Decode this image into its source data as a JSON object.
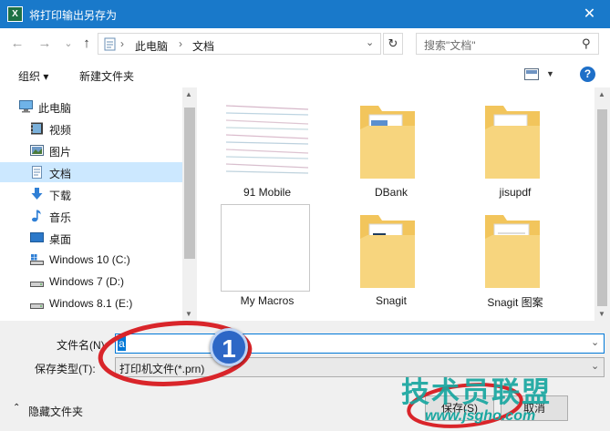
{
  "window": {
    "title": "将打印输出另存为",
    "app_icon": "X",
    "close": "✕"
  },
  "nav": {
    "back": "←",
    "forward": "→",
    "recent": "⌄",
    "up": "↑",
    "breadcrumb": [
      "此电脑",
      "文档"
    ],
    "separator": "›",
    "search_placeholder": "搜索\"文档\"",
    "refresh": "↻"
  },
  "toolbar": {
    "organize": "组织 ▾",
    "new_folder": "新建文件夹",
    "help": "?"
  },
  "sidebar": {
    "items": [
      {
        "label": "此电脑",
        "icon": "pc-icon"
      },
      {
        "label": "视频",
        "icon": "video-icon"
      },
      {
        "label": "图片",
        "icon": "picture-icon"
      },
      {
        "label": "文档",
        "icon": "document-icon"
      },
      {
        "label": "下载",
        "icon": "download-icon"
      },
      {
        "label": "音乐",
        "icon": "music-icon"
      },
      {
        "label": "桌面",
        "icon": "desktop-icon"
      },
      {
        "label": "Windows 10 (C:)",
        "icon": "drive-icon"
      },
      {
        "label": "Windows 7 (D:)",
        "icon": "drive-icon"
      },
      {
        "label": "Windows 8.1 (E:)",
        "icon": "drive-icon"
      }
    ]
  },
  "files": [
    {
      "name": "91 Mobile",
      "type": "image-thumbnail"
    },
    {
      "name": "DBank",
      "type": "folder"
    },
    {
      "name": "jisupdf",
      "type": "folder"
    },
    {
      "name": "My Macros",
      "type": "blank-thumbnail"
    },
    {
      "name": "Snagit",
      "type": "folder"
    },
    {
      "name": "Snagit 图案",
      "type": "folder"
    }
  ],
  "form": {
    "filename_label": "文件名(N):",
    "filename_value": "a",
    "filetype_label": "保存类型(T):",
    "filetype_value": "打印机文件(*.prn)",
    "hide_folders": "隐藏文件夹",
    "save_button": "保存(S)",
    "cancel_button": "取消",
    "annotation": "1"
  },
  "watermark": {
    "text": "技术员联盟",
    "url": "www.jsgho.com"
  },
  "colors": {
    "titlebar": "#1979ca",
    "selected": "#cce8ff",
    "folder": "#f2c55c",
    "watermark": "#19a7a0",
    "annotation": "#d9252a"
  }
}
